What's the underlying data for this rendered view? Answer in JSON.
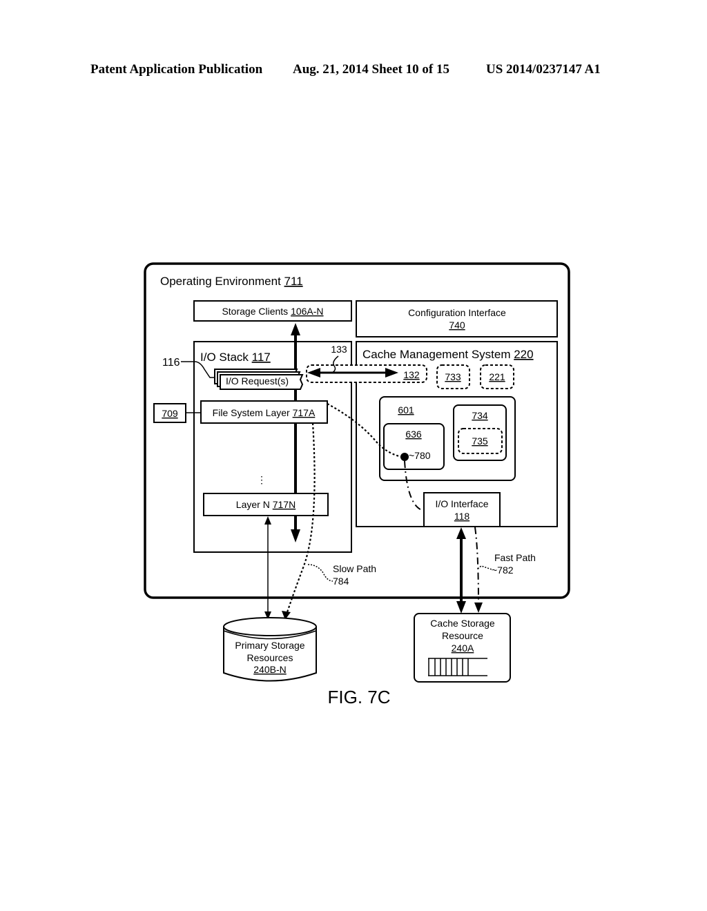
{
  "header": {
    "left": "Patent Application Publication",
    "middle": "Aug. 21, 2014  Sheet 10 of 15",
    "right": "US 2014/0237147 A1"
  },
  "diagram": {
    "operating_environment": {
      "label": "Operating Environment ",
      "ref": "711"
    },
    "storage_clients": {
      "label": "Storage Clients ",
      "ref": "106A-N"
    },
    "config_interface": {
      "label": "Configuration Interface",
      "ref": "740"
    },
    "io_stack": {
      "label": "I/O Stack ",
      "ref": "117"
    },
    "io_requests": {
      "label": "I/O Request(s)",
      "callout": "116"
    },
    "callout_133": "133",
    "cms": {
      "label": "Cache Management System ",
      "ref": "220"
    },
    "box_132": "132",
    "box_733": "733",
    "box_221": "221",
    "box_709": "709",
    "fs_layer": {
      "label": "File System Layer ",
      "ref": "717A"
    },
    "ellipsis": "⋮",
    "layer_n": {
      "label": "Layer N ",
      "ref": "717N"
    },
    "box_601": "601",
    "box_636": "636",
    "point_780": "~780",
    "box_734": "734",
    "box_735": "735",
    "io_interface": {
      "label": "I/O Interface",
      "ref": "118"
    },
    "fast_path": {
      "label": "Fast Path",
      "ref": "~782"
    },
    "slow_path": {
      "label": "Slow Path",
      "ref": "784"
    },
    "primary_storage": {
      "line1": "Primary Storage",
      "line2": "Resources",
      "ref": "240B-N"
    },
    "cache_storage": {
      "line1": "Cache Storage",
      "line2": "Resource",
      "ref": "240A"
    },
    "figure_label": "FIG. 7C"
  }
}
